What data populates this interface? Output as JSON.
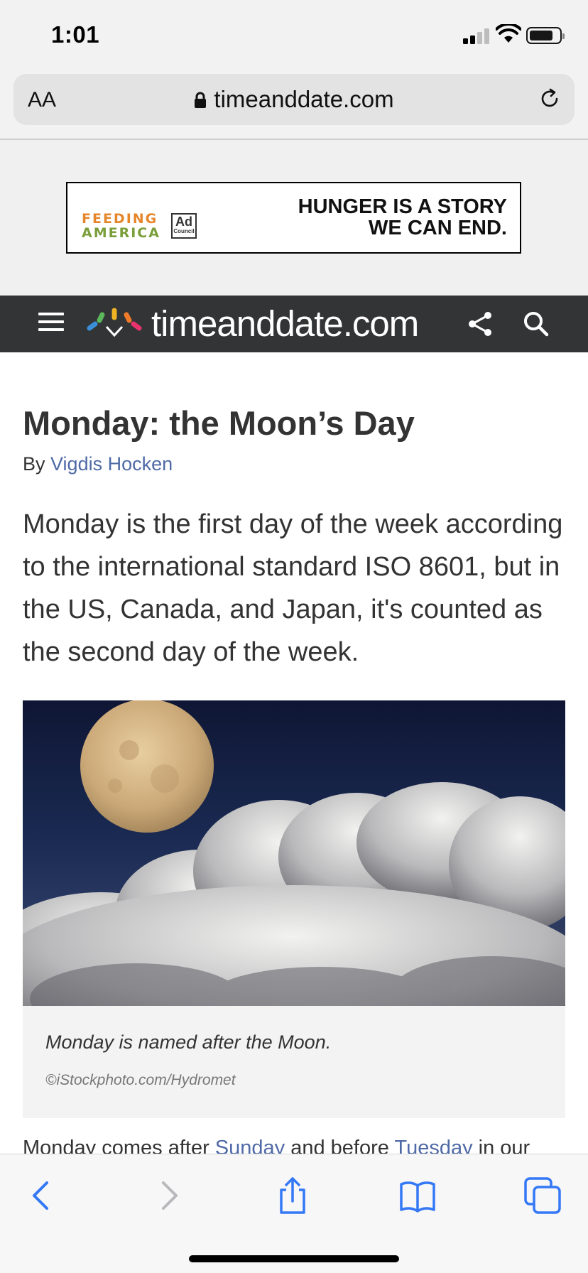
{
  "status_bar": {
    "time": "1:01"
  },
  "browser": {
    "text_size_label": "AA",
    "url": "timeanddate.com"
  },
  "ad": {
    "logo_line1": "FEEDING",
    "logo_line2": "AMERICA",
    "council_label": "Ad",
    "council_sub": "Council",
    "headline_line1": "HUNGER IS A STORY",
    "headline_line2": "WE CAN END."
  },
  "site_nav": {
    "site_name": "timeanddate.com"
  },
  "article": {
    "title": "Monday: the Moon’s Day",
    "byline_prefix": "By",
    "author": "Vigdis Hocken",
    "lead": "Monday is the first day of the week according to the international standard ISO 8601, but in the US, Canada, and Japan, it's counted as the second day of the week.",
    "figure_caption": "Monday is named after the Moon.",
    "figure_credit": "©iStockphoto.com/Hydromet",
    "body_start": "Monday comes after",
    "link_sunday": "Sunday",
    "body_mid": "and before",
    "link_tuesday": "Tuesday",
    "body_end": "in our"
  },
  "colors": {
    "link": "#4f6aa6",
    "nav_background": "#333436",
    "ios_blue": "#3478f6"
  },
  "icons": {
    "address_bar": [
      "lock-icon",
      "reload-icon"
    ],
    "nav": [
      "menu-icon",
      "site-logo",
      "share-icon",
      "search-icon"
    ],
    "toolbar": [
      "back-icon",
      "forward-icon",
      "share-icon",
      "bookmarks-icon",
      "tabs-icon"
    ]
  }
}
